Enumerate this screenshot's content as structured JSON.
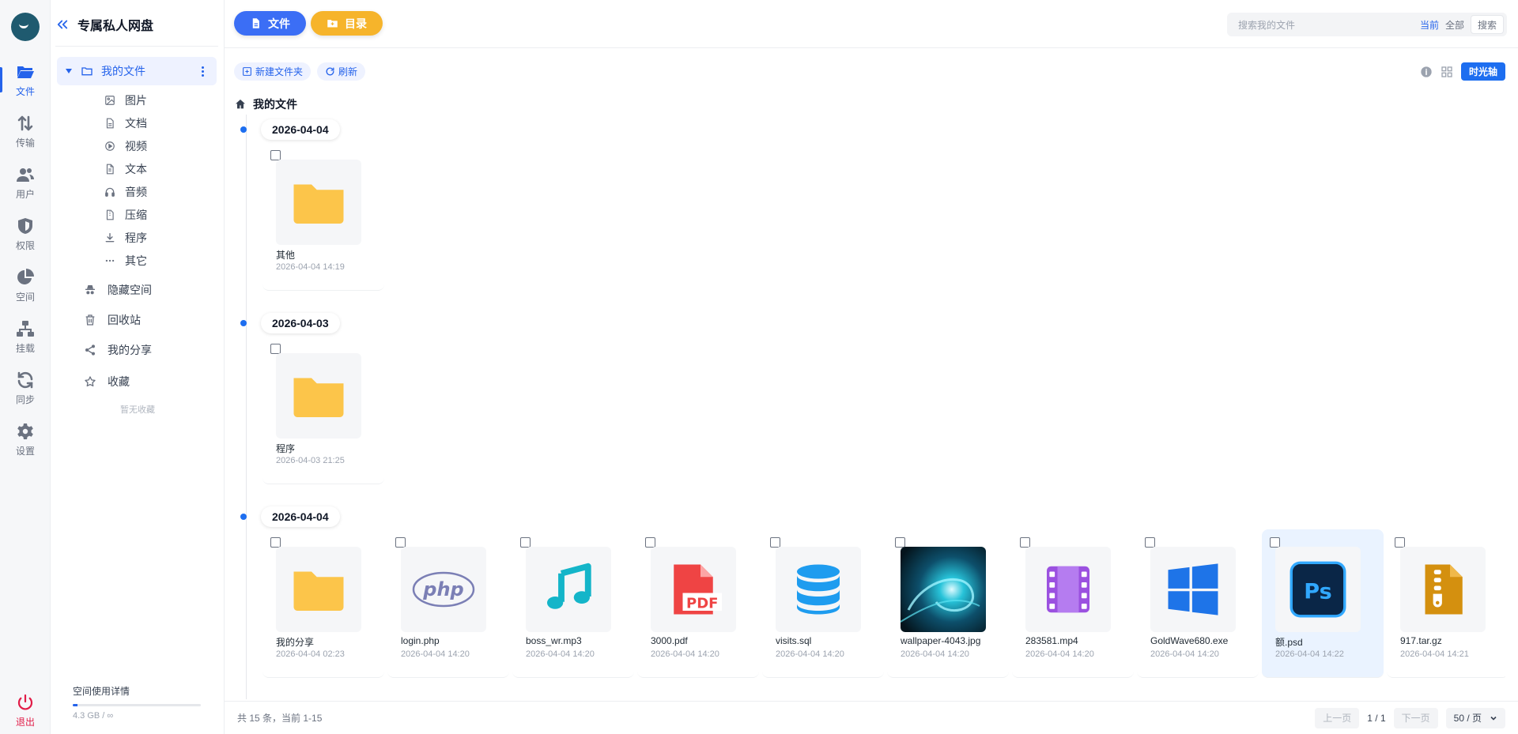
{
  "app": {
    "title": "专属私人网盘"
  },
  "rail": [
    {
      "label": "文件",
      "icon": "folder-open-icon",
      "active": true
    },
    {
      "label": "传输",
      "icon": "transfer-icon"
    },
    {
      "label": "用户",
      "icon": "users-icon"
    },
    {
      "label": "权限",
      "icon": "shield-icon"
    },
    {
      "label": "空间",
      "icon": "pie-chart-icon"
    },
    {
      "label": "挂载",
      "icon": "network-icon"
    },
    {
      "label": "同步",
      "icon": "sync-icon"
    },
    {
      "label": "设置",
      "icon": "gear-icon"
    }
  ],
  "logout": {
    "label": "退出",
    "icon": "power-icon"
  },
  "sidebar": {
    "my_files": "我的文件",
    "categories": [
      {
        "label": "图片",
        "icon": "image-icon"
      },
      {
        "label": "文档",
        "icon": "document-icon"
      },
      {
        "label": "视频",
        "icon": "play-circle-icon"
      },
      {
        "label": "文本",
        "icon": "text-file-icon"
      },
      {
        "label": "音频",
        "icon": "headphones-icon"
      },
      {
        "label": "压缩",
        "icon": "archive-icon"
      },
      {
        "label": "程序",
        "icon": "download-icon"
      },
      {
        "label": "其它",
        "icon": "ellipsis-icon"
      }
    ],
    "sections": [
      {
        "label": "隐藏空间",
        "icon": "incognito-icon"
      },
      {
        "label": "回收站",
        "icon": "trash-icon"
      },
      {
        "label": "我的分享",
        "icon": "share-icon"
      },
      {
        "label": "收藏",
        "icon": "star-icon"
      }
    ],
    "favorites_empty": "暂无收藏",
    "usage": {
      "label": "空间使用详情",
      "value": "4.3 GB / ∞",
      "fraction": 0.04
    }
  },
  "topbar": {
    "files_button": "文件",
    "directory_button": "目录",
    "search_placeholder": "搜索我的文件",
    "scope_current": "当前",
    "scope_all": "全部",
    "search_button": "搜索"
  },
  "toolbar": {
    "new_folder": "新建文件夹",
    "refresh": "刷新",
    "timeline": "时光轴"
  },
  "breadcrumb": {
    "root": "我的文件"
  },
  "groups": [
    {
      "date": "2026-04-04",
      "files": [
        {
          "name": "其他",
          "time": "2026-04-04 14:19",
          "type": "folder"
        }
      ]
    },
    {
      "date": "2026-04-03",
      "files": [
        {
          "name": "程序",
          "time": "2026-04-03 21:25",
          "type": "folder"
        }
      ]
    },
    {
      "date": "2026-04-04",
      "files": [
        {
          "name": "我的分享",
          "time": "2026-04-04 02:23",
          "type": "folder"
        },
        {
          "name": "login.php",
          "time": "2026-04-04 14:20",
          "type": "php"
        },
        {
          "name": "boss_wr.mp3",
          "time": "2026-04-04 14:20",
          "type": "audio"
        },
        {
          "name": "3000.pdf",
          "time": "2026-04-04 14:20",
          "type": "pdf"
        },
        {
          "name": "visits.sql",
          "time": "2026-04-04 14:20",
          "type": "database"
        },
        {
          "name": "wallpaper-4043.jpg",
          "time": "2026-04-04 14:20",
          "type": "image"
        },
        {
          "name": "283581.mp4",
          "time": "2026-04-04 14:20",
          "type": "video"
        },
        {
          "name": "GoldWave680.exe",
          "time": "2026-04-04 14:20",
          "type": "exe"
        },
        {
          "name": "额.psd",
          "time": "2026-04-04 14:22",
          "type": "psd",
          "selected": true
        },
        {
          "name": "917.tar.gz",
          "time": "2026-04-04 14:21",
          "type": "archive"
        }
      ]
    }
  ],
  "footer": {
    "total": "共 15 条，当前 1-15",
    "prev": "上一页",
    "page": "1 / 1",
    "next": "下一页",
    "page_size": "50 / 页"
  },
  "colors": {
    "accent": "#1d6ef0",
    "folder": "#fcc54a",
    "directory_button": "#f6b42b"
  }
}
